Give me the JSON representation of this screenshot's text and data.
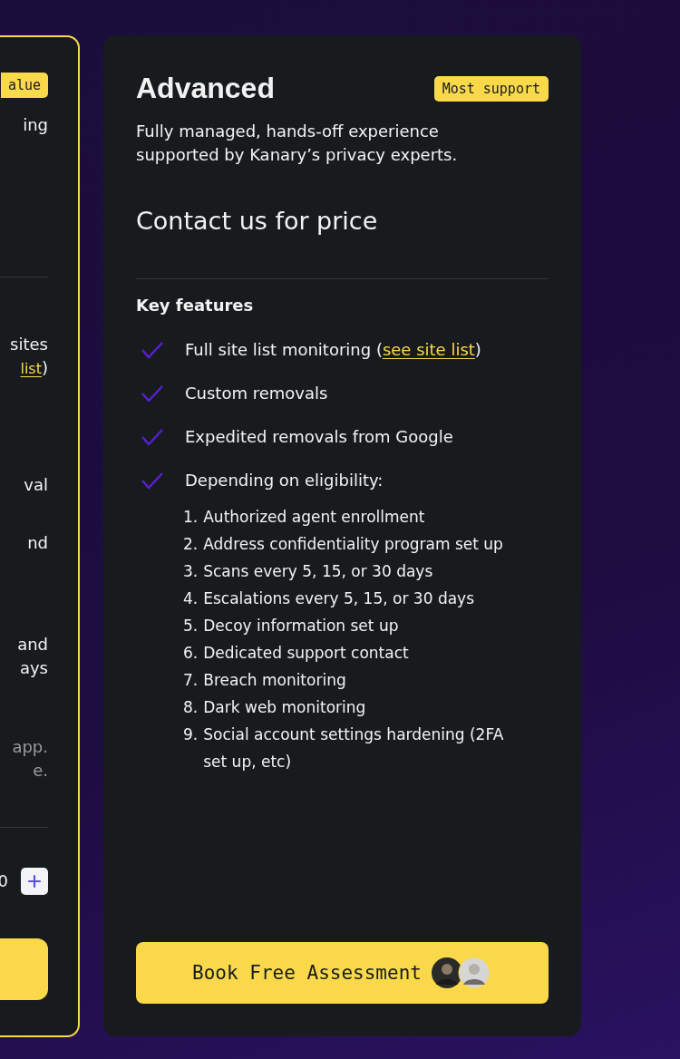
{
  "left_card": {
    "badge": "alue",
    "lines": [
      {
        "kind": "text",
        "text": "ing"
      },
      {
        "kind": "divider"
      },
      {
        "kind": "text",
        "text": "sites"
      },
      {
        "kind": "link_line",
        "link": "list",
        "after": ")"
      },
      {
        "kind": "text",
        "text": "val"
      },
      {
        "kind": "text",
        "text": "nd"
      },
      {
        "kind": "text",
        "text": "and"
      },
      {
        "kind": "text",
        "text": "ays"
      },
      {
        "kind": "muted",
        "text": "app."
      },
      {
        "kind": "muted",
        "text": "e."
      },
      {
        "kind": "divider"
      },
      {
        "kind": "counter",
        "text": "0"
      },
      {
        "kind": "button"
      }
    ]
  },
  "card": {
    "title": "Advanced",
    "badge": "Most support",
    "description": "Fully managed, hands-off experience supported by Kanary’s privacy experts.",
    "price": "Contact us for price",
    "features_heading": "Key features",
    "features": [
      {
        "text": "Full site list monitoring (",
        "link": "see site list",
        "after": ")"
      },
      {
        "text": "Custom removals"
      },
      {
        "text": "Expedited removals from Google"
      },
      {
        "text": "Depending on eligibility:"
      }
    ],
    "eligibility": [
      {
        "number": "1.",
        "text": "Authorized agent enrollment"
      },
      {
        "number": "2.",
        "text": "Address confidentiality program set up"
      },
      {
        "number": "3.",
        "text": "Scans every 5, 15, or 30 days"
      },
      {
        "number": "4.",
        "text": "Escalations every 5, 15, or 30 days"
      },
      {
        "number": "5.",
        "text": "Decoy information set up"
      },
      {
        "number": "6.",
        "text": "Dedicated support contact"
      },
      {
        "number": "7.",
        "text": "Breach monitoring"
      },
      {
        "number": "8.",
        "text": "Dark web monitoring"
      },
      {
        "number": "9.",
        "text": "Social account settings hardening (2FA set up, etc)"
      }
    ],
    "button": "Book Free Assessment"
  }
}
